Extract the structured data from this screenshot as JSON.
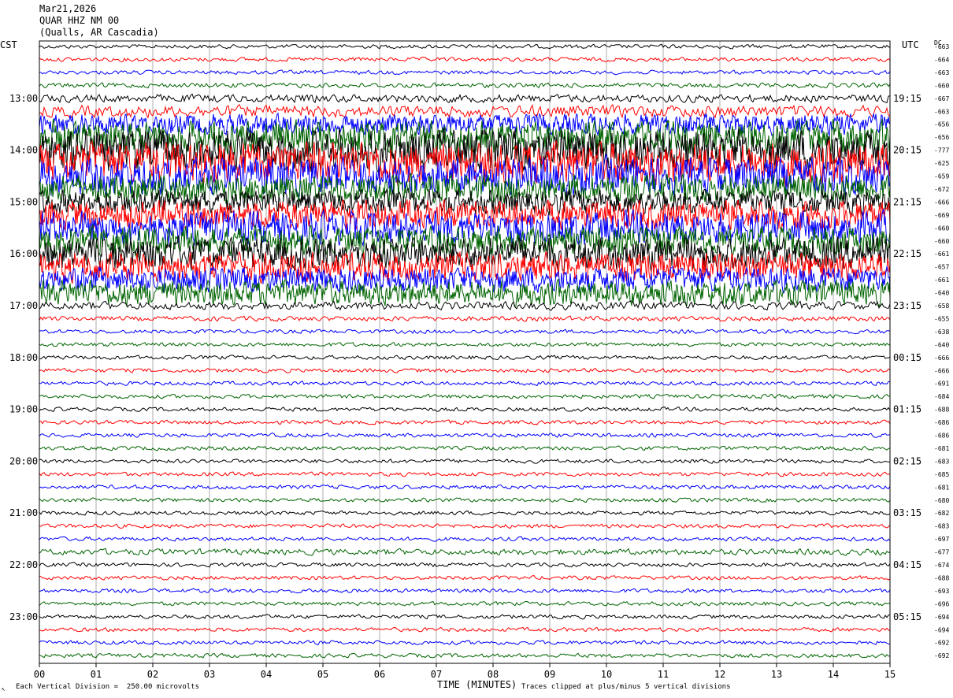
{
  "header": {
    "date": "Mar21,2026",
    "station": "QUAR HHZ NM 00",
    "location": "(Qualls, AR Cascadia)"
  },
  "left_tz": "CST",
  "right_tz": "UTC",
  "dc_label": "DC",
  "footer": {
    "scale_note": "Each Vertical Division =  250.00 microvolts",
    "clip_note": "Traces clipped at plus/minus 5 vertical divisions",
    "corner_mark": "↖"
  },
  "colors": {
    "cycle": [
      "#000000",
      "#ff0000",
      "#0000ff",
      "#006400"
    ]
  },
  "chart_data": {
    "type": "line",
    "title": "QUAR HHZ NM 00",
    "xlabel": "TIME (MINUTES)",
    "ylabel": "",
    "x_ticks": [
      "00",
      "01",
      "02",
      "03",
      "04",
      "05",
      "06",
      "07",
      "08",
      "09",
      "10",
      "11",
      "12",
      "13",
      "14",
      "15"
    ],
    "xlim": [
      0,
      15
    ],
    "left_labels": [
      "13:00",
      "14:00",
      "15:00",
      "16:00",
      "17:00",
      "18:00",
      "19:00",
      "20:00",
      "21:00",
      "22:00",
      "23:00"
    ],
    "right_labels": [
      "19:15",
      "20:15",
      "21:15",
      "22:15",
      "23:15",
      "00:15",
      "01:15",
      "02:15",
      "03:15",
      "04:15",
      "05:15"
    ],
    "label_every_n_traces": 4,
    "label_start_trace": 4,
    "trace_count": 48,
    "dc_offsets": [
      "-663",
      "-664",
      "-663",
      "-660",
      "-667",
      "-663",
      "-656",
      "-656",
      "-777",
      "-625",
      "-659",
      "-672",
      "-666",
      "-669",
      "-660",
      "-660",
      "-661",
      "-657",
      "-661",
      "-640",
      "-658",
      "-655",
      "-638",
      "-640",
      "-666",
      "-666",
      "-691",
      "-684",
      "-688",
      "-686",
      "-686",
      "-681",
      "-683",
      "-685",
      "-681",
      "-680",
      "-682",
      "-683",
      "-697",
      "-677",
      "-674",
      "-688",
      "-693",
      "-696",
      "-694",
      "-694",
      "-692",
      "-692"
    ],
    "trace_amplitude": [
      1,
      1,
      1,
      1.2,
      2,
      3,
      5,
      8,
      10,
      10,
      9,
      7,
      6,
      7,
      8,
      7,
      8,
      7,
      6,
      6,
      2,
      1.2,
      1,
      1,
      1,
      1,
      1,
      1,
      1,
      1,
      1,
      1,
      1,
      1,
      1,
      1,
      1,
      1,
      1,
      1.5,
      1,
      1,
      1,
      1,
      1,
      1,
      1,
      1
    ]
  }
}
